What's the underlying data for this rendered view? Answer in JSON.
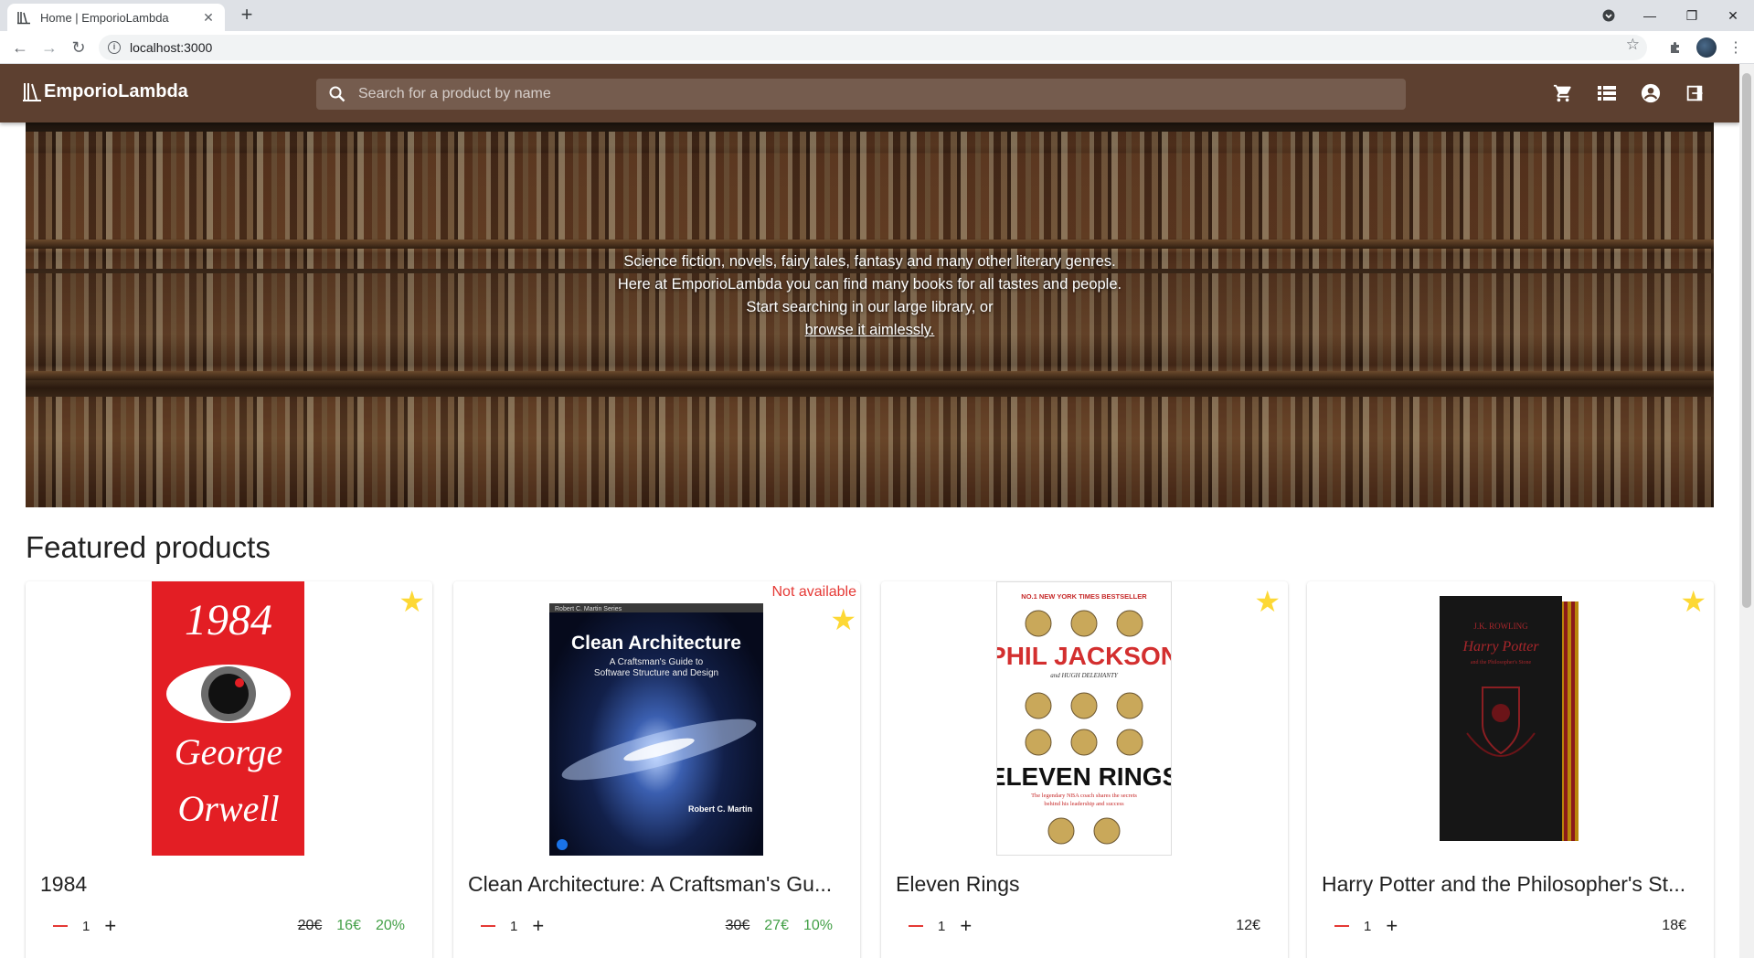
{
  "browser": {
    "tab_title": "Home | EmporioLambda",
    "url": "localhost:3000",
    "icons": [
      "back-icon",
      "forward-icon",
      "reload-icon",
      "info-icon",
      "star-icon",
      "extensions-icon",
      "profile-avatar",
      "menu-icon"
    ]
  },
  "app": {
    "brand": "EmporioLambda",
    "search_placeholder": "Search for a product by name",
    "icons": [
      "cart-icon",
      "list-icon",
      "account-icon",
      "logout-icon"
    ],
    "colors": {
      "appbar": "#5d4030",
      "star": "#fdd835",
      "discount": "#43a047",
      "alert": "#e53935"
    }
  },
  "hero": {
    "line1": "Science fiction, novels, fairy tales, fantasy and many other literary genres.",
    "line2": "Here at EmporioLambda you can find many books for all tastes and people.",
    "line3": "Start searching in our large library, or",
    "link": "browse it aimlessly."
  },
  "featured": {
    "title": "Featured products",
    "products": [
      {
        "title": "1984",
        "qty": "1",
        "old_price": "20€",
        "price": "16€",
        "discount": "20%",
        "available": true,
        "cover": {
          "top": "1984",
          "author1": "George",
          "author2": "Orwell"
        }
      },
      {
        "title": "Clean Architecture: A Craftsman's Gu...",
        "qty": "1",
        "old_price": "30€",
        "price": "27€",
        "discount": "10%",
        "available": false,
        "unavailable_label": "Not available",
        "cover": {
          "series": "Robert C. Martin Series",
          "title": "Clean Architecture",
          "subtitle1": "A Craftsman's Guide to",
          "subtitle2": "Software Structure and Design",
          "author": "Robert C. Martin"
        }
      },
      {
        "title": "Eleven Rings",
        "qty": "1",
        "price": "12€",
        "available": true,
        "cover": {
          "badge": "NO.1 NEW YORK TIMES BESTSELLER",
          "author": "PHIL JACKSON",
          "coauthor": "and HUGH DELEHANTY",
          "title": "ELEVEN RINGS",
          "tagline1": "The legendary NBA coach shares the secrets",
          "tagline2": "behind his leadership and success"
        }
      },
      {
        "title": "Harry Potter and the Philosopher's St...",
        "qty": "1",
        "price": "18€",
        "available": true,
        "cover": {
          "author": "J.K. ROWLING",
          "title1": "Harry Potter",
          "title2": "and the Philosopher's Stone"
        }
      }
    ]
  }
}
